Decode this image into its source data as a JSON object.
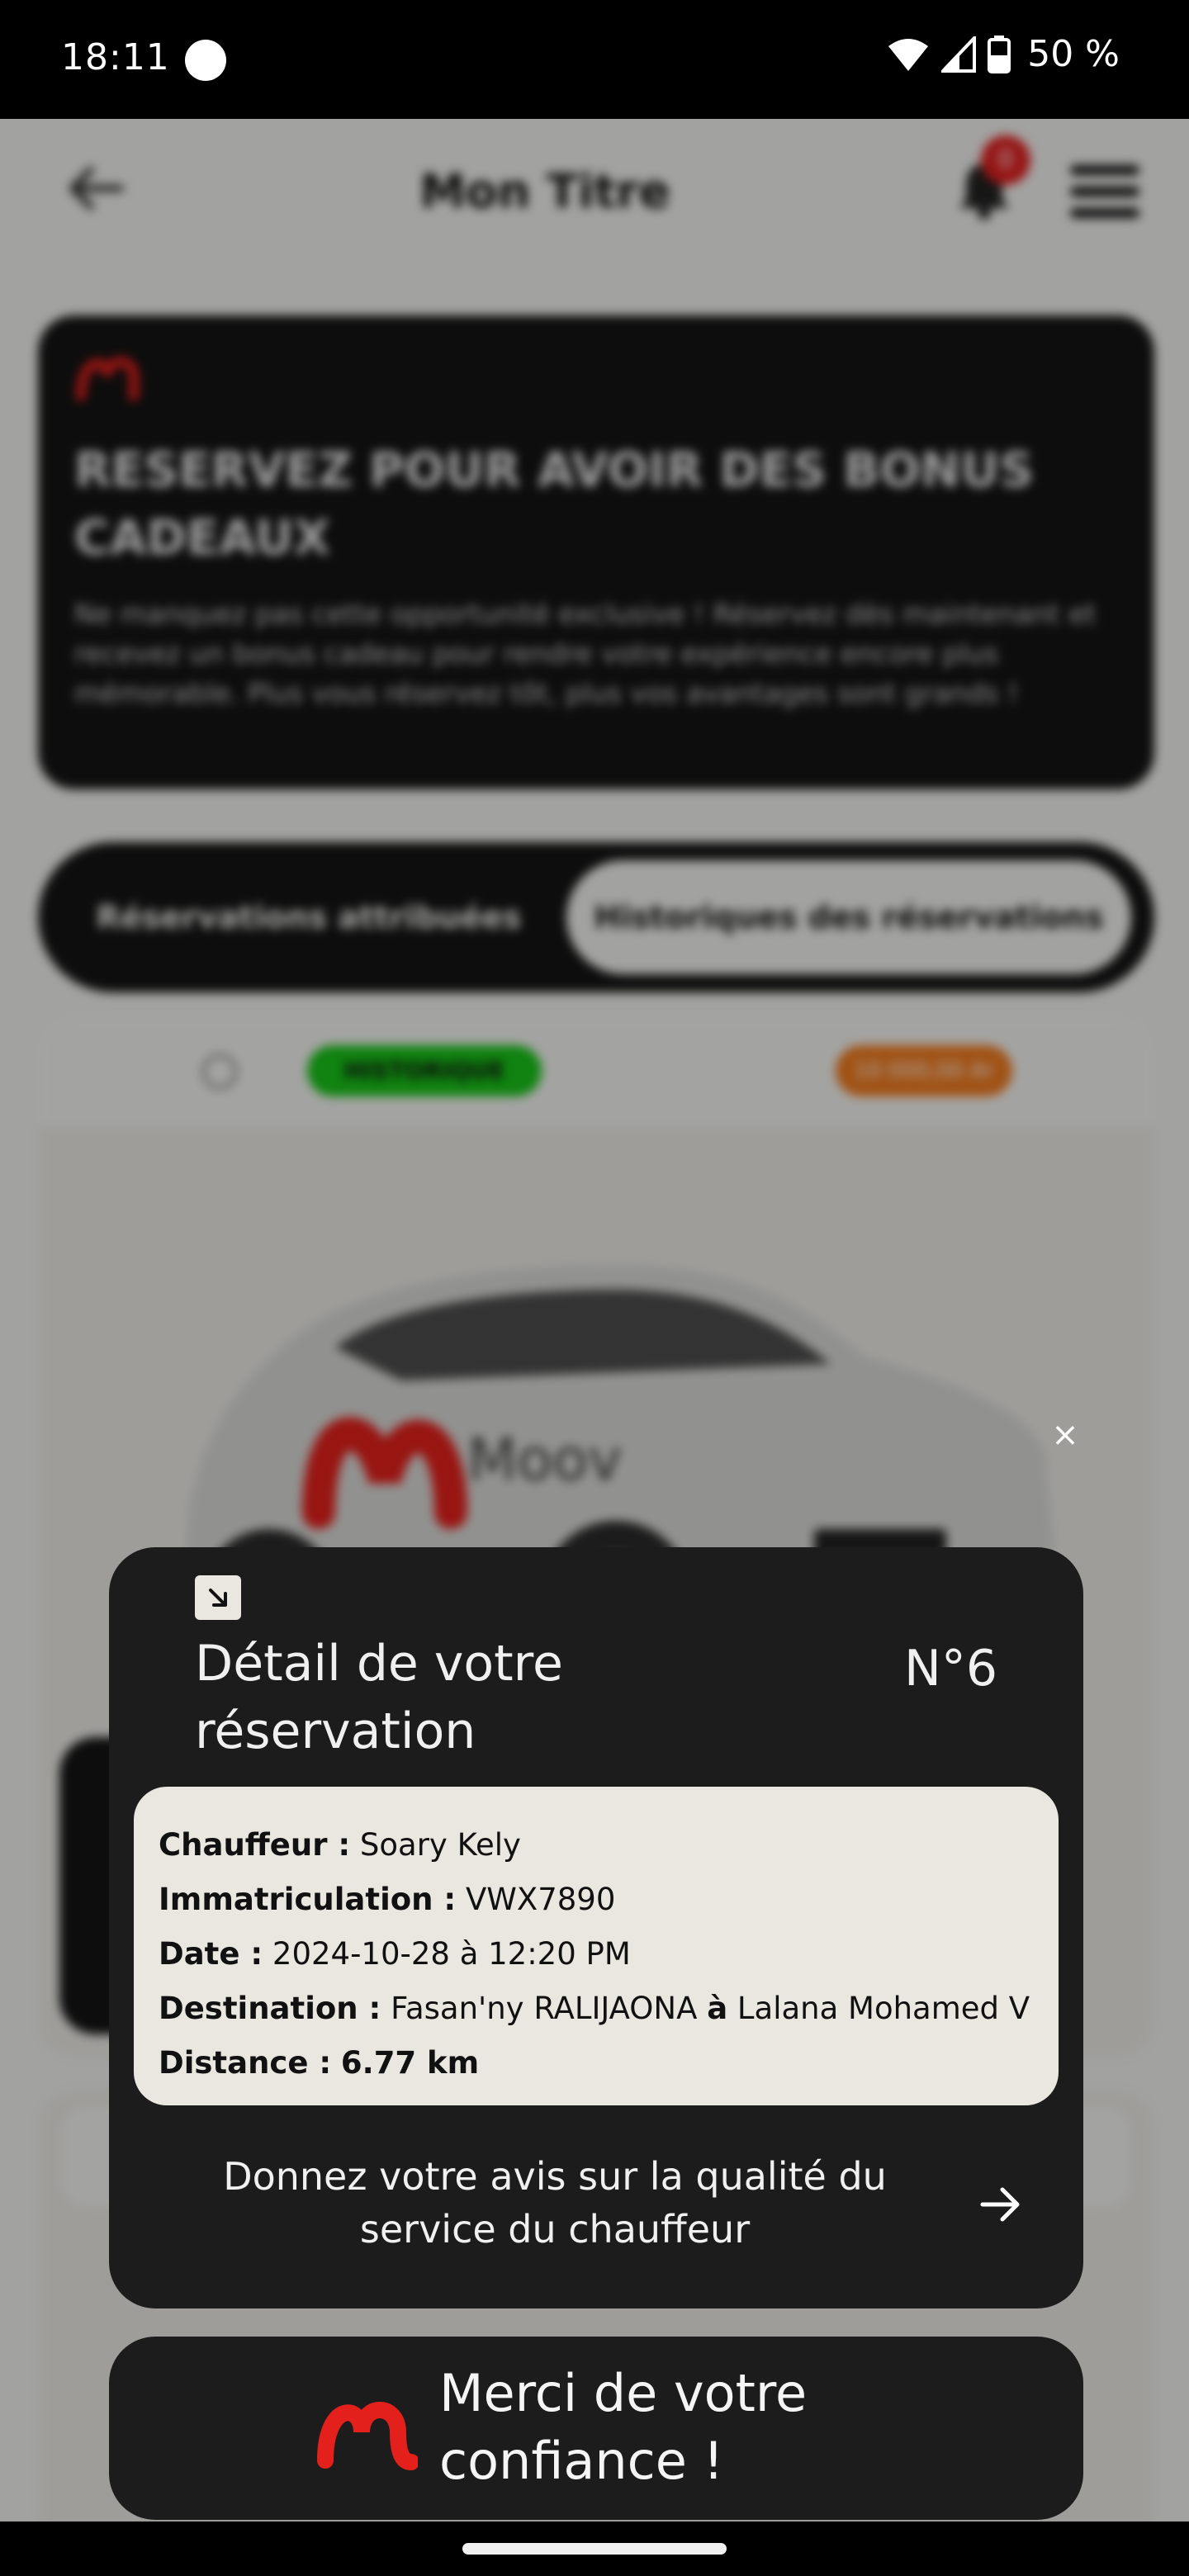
{
  "status_bar": {
    "time": "18:11",
    "battery": "50 %"
  },
  "header": {
    "title": "Mon Titre",
    "notification_count": "0"
  },
  "promo": {
    "title": "RESERVEZ POUR AVOIR DES BONUS CADEAUX",
    "text": "Ne manquez pas cette opportunité exclusive ! Réservez dès maintenant et recevez un bonus cadeau pour rendre votre expérience encore plus mémorable. Plus vous réservez tôt, plus vos avantages sont grands !"
  },
  "tabs": {
    "assigned": "Réservations attribuées",
    "history": "Historiques des réservations"
  },
  "card": {
    "status_badge": "HISTORIQUE",
    "price_badge": "10 000,00 Ar",
    "car_brand": "Moov"
  },
  "modal": {
    "title": "Détail de votre réservation",
    "number": "N°6",
    "details": [
      {
        "label": "Chauffeur :",
        "value": "Soary Kely"
      },
      {
        "label": "Immatriculation :",
        "value": "VWX7890"
      },
      {
        "label": "Date :",
        "value": "2024-10-28 à 12:20 PM"
      },
      {
        "label": "Destination :",
        "value_from": "Fasan'ny RALIJAONA",
        "connector": "à",
        "value_to": "Lalana Mohamed V"
      },
      {
        "label": "Distance :",
        "value": "6.77 km"
      }
    ],
    "feedback": "Donnez votre avis sur la qualité du service du chauffeur"
  },
  "thanks": {
    "text": "Merci de votre confiance !"
  },
  "colors": {
    "brand_red": "#e3201b",
    "modal_bg": "#1c1c1c",
    "detail_bg": "#e9e7e0",
    "status_green": "#18c318",
    "badge_orange": "#f07b20"
  }
}
